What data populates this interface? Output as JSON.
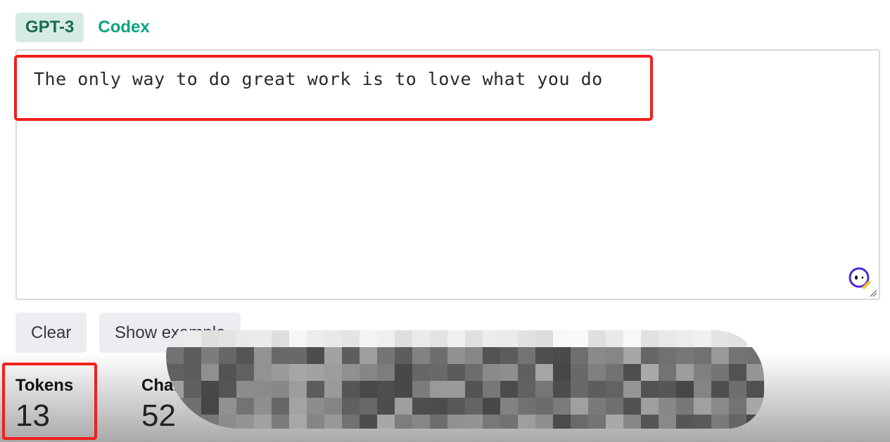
{
  "tabs": [
    {
      "label": "GPT-3",
      "active": true
    },
    {
      "label": "Codex",
      "active": false
    }
  ],
  "input": {
    "value": "The only way to do great work is to love what you do"
  },
  "buttons": {
    "clear": "Clear",
    "show_example": "Show example"
  },
  "stats": {
    "tokens_label": "Tokens",
    "tokens_value": "13",
    "characters_label": "Characters",
    "characters_value": "52"
  },
  "colors": {
    "accent": "#10a37f",
    "highlight": "#f0201c"
  },
  "icons": {
    "assistant": "grammar-assistant-icon",
    "resize": "resize-grip-icon"
  }
}
